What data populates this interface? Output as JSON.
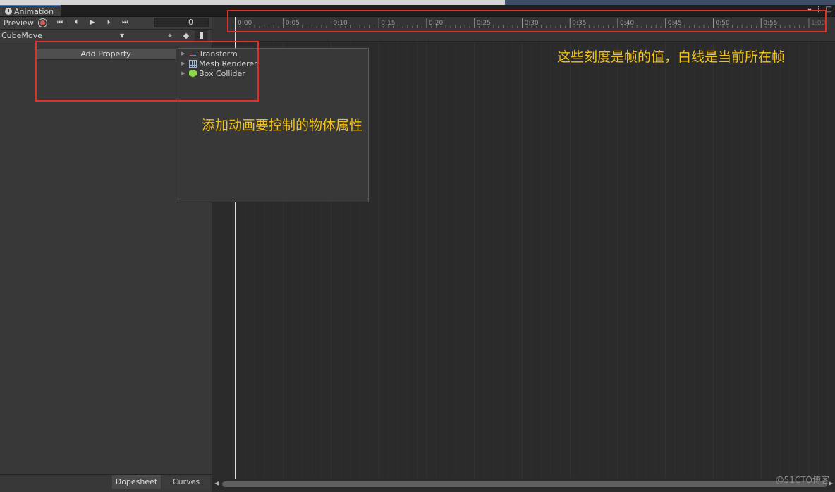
{
  "window": {
    "tab_label": "Animation",
    "controls": [
      "lock-icon",
      "menu-icon",
      "maximize-icon"
    ]
  },
  "toolbar": {
    "preview_label": "Preview",
    "record_icon": "record-icon",
    "first_key_icon": "⏮",
    "prev_key_icon": "⏴",
    "play_icon": "▶",
    "next_key_icon": "⏵",
    "last_key_icon": "⏭",
    "frame_value": "0"
  },
  "clip": {
    "selected": "CubeMove",
    "filter_icon": "⌖",
    "add_event_icon": "◆"
  },
  "properties": {
    "add_button_label": "Add Property",
    "items": [
      {
        "label": "Transform",
        "icon": "transform-icon"
      },
      {
        "label": "Mesh Renderer",
        "icon": "mesh-renderer-icon"
      },
      {
        "label": "Box Collider",
        "icon": "box-collider-icon"
      }
    ]
  },
  "ruler": {
    "labels": [
      "0:00",
      "0:05",
      "0:10",
      "0:15",
      "0:20",
      "0:25",
      "0:30",
      "0:35",
      "0:40",
      "0:45",
      "0:50",
      "0:55",
      "1:00"
    ]
  },
  "bottom_tabs": {
    "dopesheet": "Dopesheet",
    "curves": "Curves"
  },
  "annotations": {
    "ruler_note": "这些刻度是帧的值，白线是当前所在帧",
    "property_note": "添加动画要控制的物体属性",
    "color": "#f0c21a",
    "box_color": "#e0302a"
  },
  "watermark": "@51CTO博客"
}
